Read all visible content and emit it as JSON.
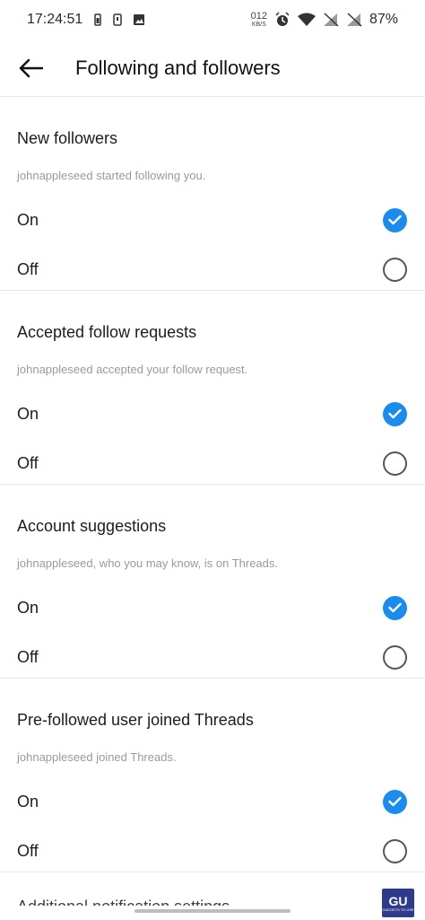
{
  "status_bar": {
    "time": "17:24:51",
    "net_speed_value": "012",
    "net_speed_unit": "KB/S",
    "battery": "87%"
  },
  "app_bar": {
    "title": "Following and followers"
  },
  "sections": [
    {
      "title": "New followers",
      "description": "johnappleseed started following you.",
      "on_label": "On",
      "off_label": "Off",
      "selected": "on"
    },
    {
      "title": "Accepted follow requests",
      "description": "johnappleseed accepted your follow request.",
      "on_label": "On",
      "off_label": "Off",
      "selected": "on"
    },
    {
      "title": "Account suggestions",
      "description": "johnappleseed, who you may know, is on Threads.",
      "on_label": "On",
      "off_label": "Off",
      "selected": "on"
    },
    {
      "title": "Pre-followed user joined Threads",
      "description": "johnappleseed joined Threads.",
      "on_label": "On",
      "off_label": "Off",
      "selected": "on"
    }
  ],
  "partial_section_title": "Additional notification settings",
  "colors": {
    "accent": "#1a8cf0",
    "divider": "#e6e6e6",
    "muted_text": "#9a9a9a"
  },
  "watermark": {
    "big": "GU",
    "small": "GADGETS TO USE"
  }
}
